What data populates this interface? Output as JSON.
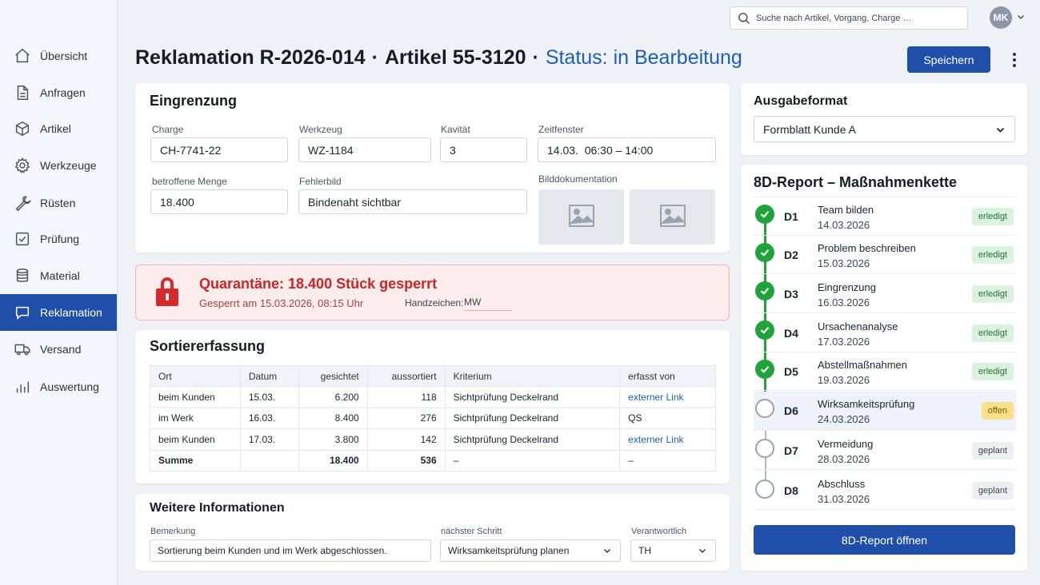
{
  "nav": [
    {
      "label": "Übersicht",
      "icon": "home-icon"
    },
    {
      "label": "Anfragen",
      "icon": "document-icon"
    },
    {
      "label": "Artikel",
      "icon": "box-icon"
    },
    {
      "label": "Werkzeuge",
      "icon": "gear-icon"
    },
    {
      "label": "Rüsten",
      "icon": "wrench-icon"
    },
    {
      "label": "Prüfung",
      "icon": "checkbox-icon"
    },
    {
      "label": "Material",
      "icon": "database-icon"
    },
    {
      "label": "Reklamation",
      "icon": "chat-icon",
      "active": true
    },
    {
      "label": "Versand",
      "icon": "truck-icon"
    },
    {
      "label": "Auswertung",
      "icon": "bar-chart-icon"
    }
  ],
  "topbar": {
    "search_placeholder": "Suche nach Artikel, Vorgang, Charge …",
    "avatar_initials": "MK"
  },
  "header": {
    "reklamation": "Reklamation R-2026-014",
    "separator": "·",
    "artikel": "Artikel 55-3120",
    "status": "Status: in Bearbeitung",
    "save_label": "Speichern"
  },
  "eingrenzung": {
    "title": "Eingrenzung",
    "charge_label": "Charge",
    "charge_value": "CH-7741-22",
    "werkzeug_label": "Werkzeug",
    "werkzeug_value": "WZ-1184",
    "kavitaet_label": "Kavität",
    "kavitaet_value": "3",
    "zeitfenster_label": "Zeitfenster",
    "zeitfenster_value": "14.03.  06:30 – 14:00",
    "menge_label": "betroffene Menge",
    "menge_value": "18.400",
    "fehlerbild_label": "Fehlerbild",
    "fehlerbild_value": "Bindenaht sichtbar",
    "bild_label": "Bilddokumentation"
  },
  "quarantaene": {
    "title": "Quarantäne: 18.400 Stück gesperrt",
    "subtitle": "Gesperrt am 15.03.2026, 08:15 Uhr",
    "handzeichen_label": "Handzeichen:",
    "handzeichen_value": "MW"
  },
  "sortier": {
    "title": "Sortiererfassung",
    "columns": [
      "Ort",
      "Datum",
      "gesichtet",
      "aussortiert",
      "Kriterium",
      "erfasst von"
    ],
    "rows": [
      [
        "beim Kunden",
        "15.03.",
        "6.200",
        "118",
        "Sichtprüfung Deckelrand",
        "externer Link"
      ],
      [
        "im Werk",
        "16.03.",
        "8.400",
        "276",
        "Sichtprüfung Deckelrand",
        "QS"
      ],
      [
        "beim Kunden",
        "17.03.",
        "3.800",
        "142",
        "Sichtprüfung Deckelrand",
        "externer Link"
      ]
    ],
    "sum": [
      "Summe",
      "",
      "18.400",
      "536",
      "–",
      "–"
    ]
  },
  "weitere": {
    "title": "Weitere Informationen",
    "bemerkung_label": "Bemerkung",
    "bemerkung_value": "Sortierung beim Kunden und im Werk abgeschlossen.",
    "schritt_label": "nächster Schritt",
    "schritt_value": "Wirksamkeitsprüfung planen",
    "verantwortlich_label": "Verantwortlich",
    "verantwortlich_value": "TH"
  },
  "ausgabe": {
    "title": "Ausgabeformat",
    "value": "Formblatt Kunde A"
  },
  "report": {
    "title": "8D-Report – Maßnahmenkette",
    "steps": [
      {
        "code": "D1",
        "name": "Team bilden",
        "date": "14.03.2026",
        "status": "erledigt",
        "kind": "done"
      },
      {
        "code": "D2",
        "name": "Problem beschreiben",
        "date": "15.03.2026",
        "status": "erledigt",
        "kind": "done"
      },
      {
        "code": "D3",
        "name": "Eingrenzung",
        "date": "16.03.2026",
        "status": "erledigt",
        "kind": "done"
      },
      {
        "code": "D4",
        "name": "Ursachenanalyse",
        "date": "17.03.2026",
        "status": "erledigt",
        "kind": "done"
      },
      {
        "code": "D5",
        "name": "Abstellmaßnahmen",
        "date": "19.03.2026",
        "status": "erledigt",
        "kind": "done"
      },
      {
        "code": "D6",
        "name": "Wirksamkeitsprüfung",
        "date": "24.03.2026",
        "status": "offen",
        "kind": "open"
      },
      {
        "code": "D7",
        "name": "Vermeidung",
        "date": "28.03.2026",
        "status": "geplant",
        "kind": "plan"
      },
      {
        "code": "D8",
        "name": "Abschluss",
        "date": "31.03.2026",
        "status": "geplant",
        "kind": "plan"
      }
    ],
    "open_label": "8D-Report öffnen"
  },
  "colors": {
    "primary": "#1f4fa8",
    "status_blue": "#1f5fb0",
    "danger": "#cc2525",
    "success": "#1fa33a",
    "warning": "#fbe08a"
  }
}
